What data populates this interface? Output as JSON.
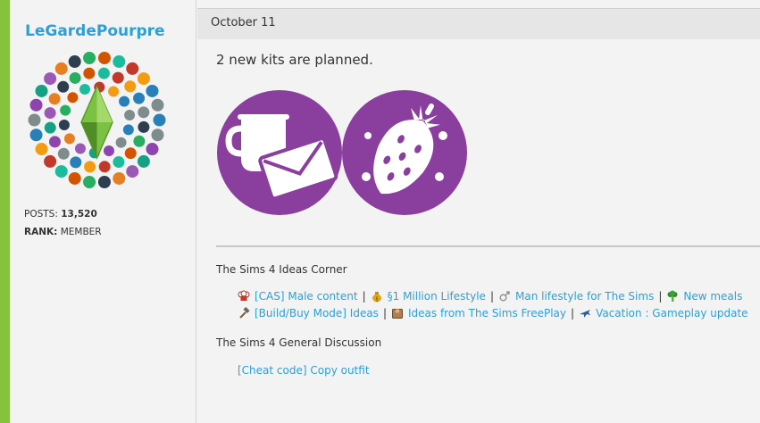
{
  "user": {
    "username": "LeGardePourpre",
    "posts_label": "POSTS:",
    "posts_value": "13,520",
    "rank_label": "RANK:",
    "rank_value": "MEMBER"
  },
  "post": {
    "date": "October 11",
    "text": "2 new kits are planned."
  },
  "signature": {
    "section1_title": "The Sims 4 Ideas Corner",
    "row1": [
      {
        "label": "[CAS] Male content",
        "icon": "chef-hat-icon"
      },
      {
        "label": "§1 Million Lifestyle",
        "icon": "money-bag-icon"
      },
      {
        "label": "Man lifestyle for The Sims",
        "icon": "male-symbol-icon"
      },
      {
        "label": "New meals",
        "icon": "broccoli-icon"
      }
    ],
    "row2": [
      {
        "label": "[Build/Buy Mode] Ideas",
        "icon": "hammer-icon"
      },
      {
        "label": "Ideas from The Sims FreePlay",
        "icon": "box-icon"
      },
      {
        "label": "Vacation : Gameplay update",
        "icon": "airplane-icon"
      }
    ],
    "section2_title": "The Sims 4 General Discussion",
    "row3_link": "[Cheat code] Copy outfit"
  },
  "colors": {
    "accent_green": "#84c43c",
    "link_blue": "#2d9fd8",
    "kit_purple": "#8a3e9e"
  }
}
